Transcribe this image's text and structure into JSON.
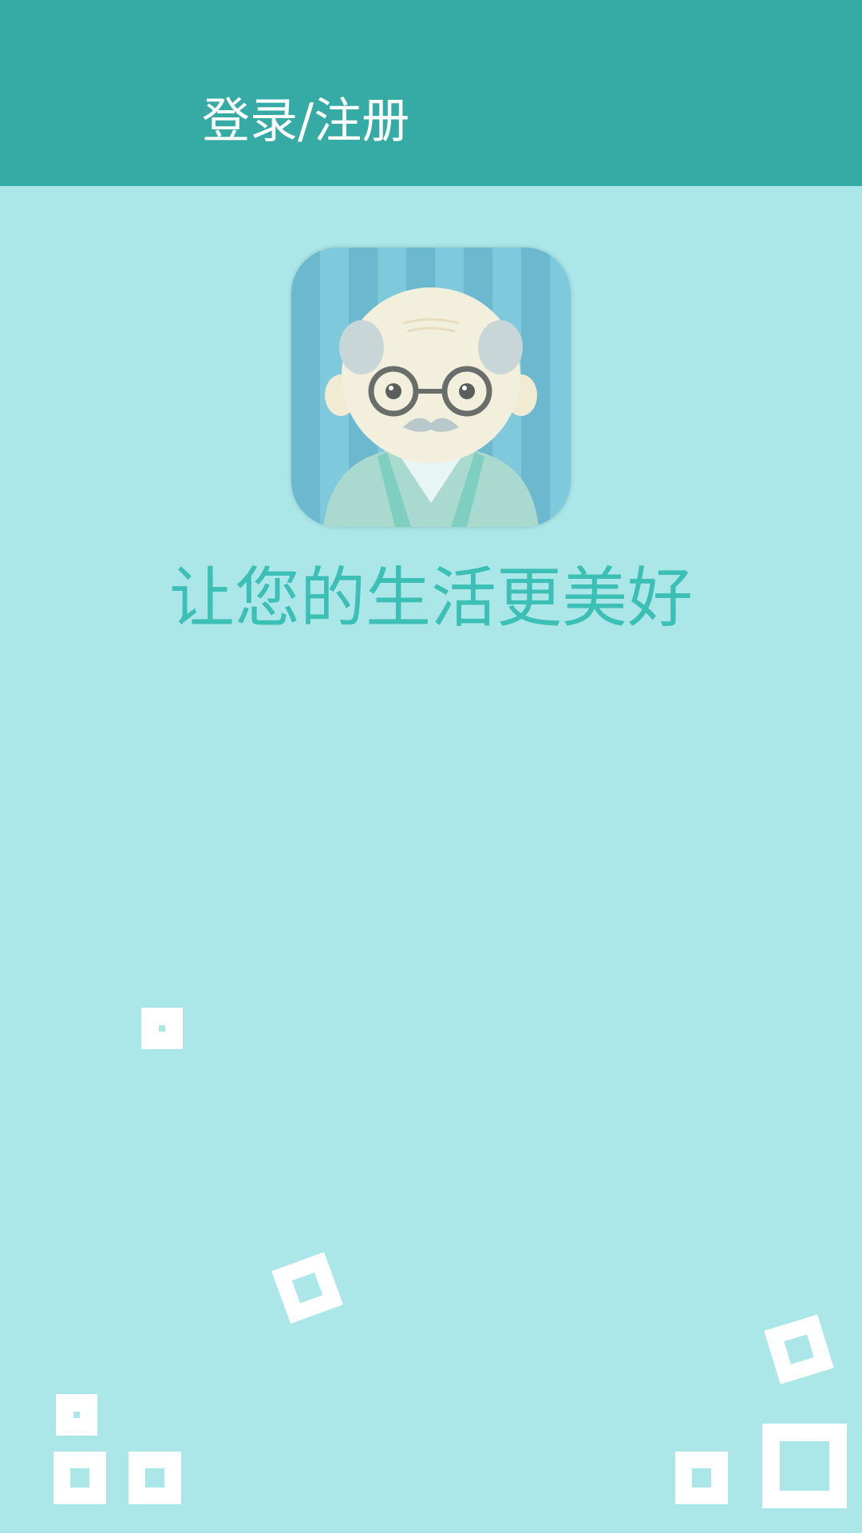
{
  "header": {
    "title": "登录/注册"
  },
  "avatar": {
    "icon": "elderly-man-avatar"
  },
  "slogan": "让您的生活更美好",
  "colors": {
    "header_bg": "#36aba6",
    "page_bg": "#abe7e8",
    "slogan": "#3cbfb4",
    "decoration": "#ffffff"
  }
}
